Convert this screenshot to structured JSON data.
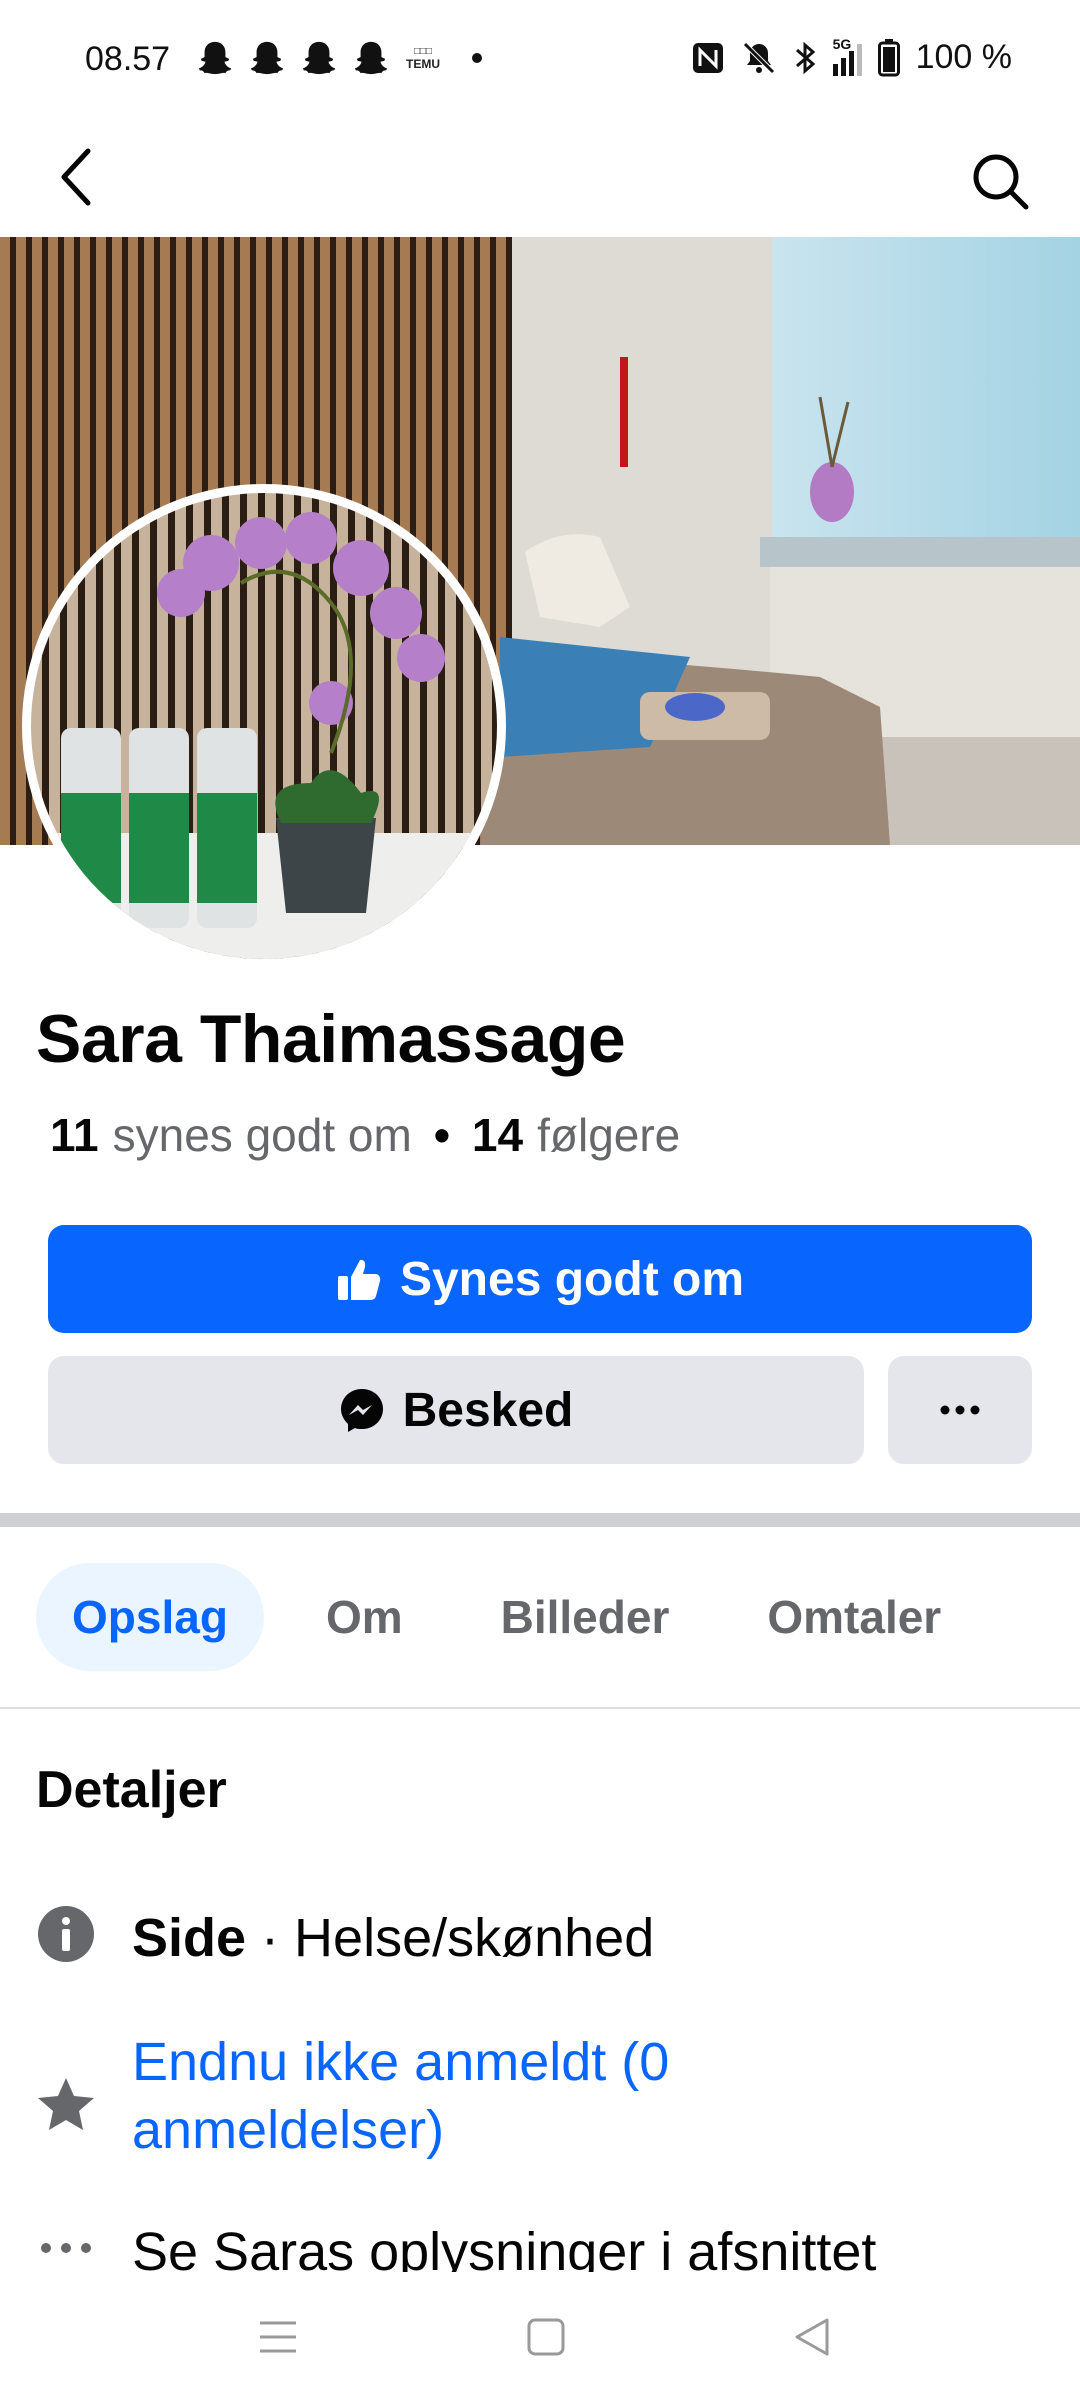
{
  "status_bar": {
    "time": "08.57",
    "temu_label": "TEMU",
    "battery_text": "100 %",
    "network": "5G",
    "icons": [
      "snapchat-ghost-icon",
      "snapchat-ghost-icon",
      "snapchat-ghost-icon",
      "snapchat-ghost-icon",
      "temu-icon",
      "notification-dot",
      "nfc-icon",
      "mute-icon",
      "bluetooth-icon",
      "signal-icon",
      "battery-icon"
    ]
  },
  "top_nav": {
    "back_icon": "back-arrow-icon",
    "search_icon": "search-icon"
  },
  "page": {
    "name": "Sara Thaimassage",
    "likes_count": "11",
    "likes_label": "synes godt om",
    "separator": "•",
    "followers_count": "14",
    "followers_label": "følgere"
  },
  "actions": {
    "like_label": "Synes godt om",
    "message_label": "Besked",
    "more_icon": "more-dots-icon"
  },
  "tabs": [
    {
      "label": "Opslag",
      "active": true
    },
    {
      "label": "Om",
      "active": false
    },
    {
      "label": "Billeder",
      "active": false
    },
    {
      "label": "Omtaler",
      "active": false
    }
  ],
  "details": {
    "title": "Detaljer",
    "category_label": "Side",
    "category_sep": " · ",
    "category_value": "Helse/skønhed",
    "reviews_text": "Endnu ikke anmeldt (0 anmeldelser)",
    "more_info_text": "Se Saras oplysninger i afsnittet"
  },
  "colors": {
    "accent": "#0866ff",
    "secondary_button": "#e4e6eb",
    "muted_text": "#65676b",
    "active_tab_bg": "#ebf5ff"
  }
}
